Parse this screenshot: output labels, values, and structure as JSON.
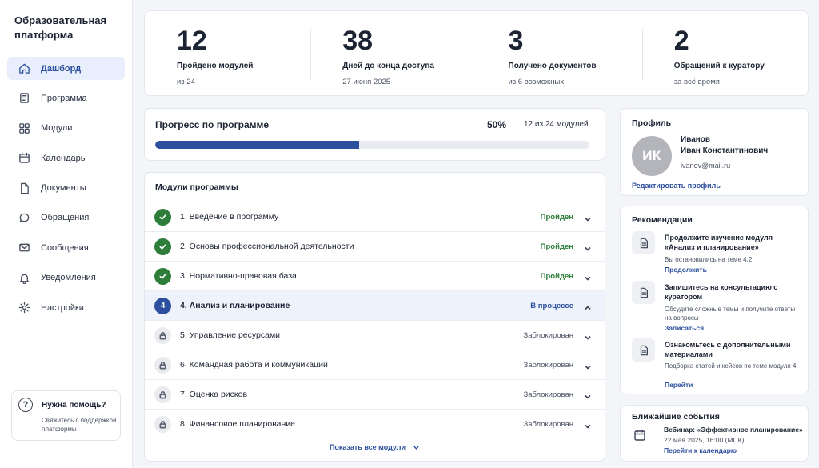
{
  "brand": {
    "line1": "Образовательная",
    "line2": "платформа"
  },
  "nav": [
    {
      "label": "Дашборд",
      "icon": "home-icon",
      "active": true
    },
    {
      "label": "Программа",
      "icon": "book-icon"
    },
    {
      "label": "Модули",
      "icon": "grid-icon"
    },
    {
      "label": "Календарь",
      "icon": "calendar-icon"
    },
    {
      "label": "Документы",
      "icon": "document-icon"
    },
    {
      "label": "Обращения",
      "icon": "chat-icon"
    },
    {
      "label": "Сообщения",
      "icon": "mail-icon"
    },
    {
      "label": "Уведомления",
      "icon": "bell-icon"
    },
    {
      "label": "Настройки",
      "icon": "gear-icon"
    }
  ],
  "help": {
    "icon": "?",
    "title": "Нужна помощь?",
    "subtitle": "Свяжитесь с поддержкой платформы"
  },
  "stats": [
    {
      "value": "12",
      "label": "Пройдено модулей",
      "sub": "из 24"
    },
    {
      "value": "38",
      "label": "Дней до конца доступа",
      "sub": "27 июня 2025"
    },
    {
      "value": "3",
      "label": "Получено документов",
      "sub": "из 6 возможных"
    },
    {
      "value": "2",
      "label": "Обращений к куратору",
      "sub": "за всё время"
    }
  ],
  "progress": {
    "title": "Прогресс по программе",
    "percent_label": "50%",
    "count_label": "12 из 24 модулей",
    "fraction": 0.47
  },
  "modules": {
    "title": "Модули программы",
    "items": [
      {
        "name": "1.  Введение в программу",
        "status": "Пройден",
        "state": "done"
      },
      {
        "name": "2.  Основы профессиональной деятельности",
        "status": "Пройден",
        "state": "done"
      },
      {
        "name": "3.  Нормативно-правовая база",
        "status": "Пройден",
        "state": "done"
      },
      {
        "name": "4.  Анализ и планирование",
        "status": "В процессе",
        "state": "current",
        "badge": "4"
      },
      {
        "name": "5.  Управление ресурсами",
        "status": "Заблокирован",
        "state": "locked"
      },
      {
        "name": "6.  Командная работа и коммуникации",
        "status": "Заблокирован",
        "state": "locked"
      },
      {
        "name": "7.  Оценка рисков",
        "status": "Заблокирован",
        "state": "locked"
      },
      {
        "name": "8.  Финансовое планирование",
        "status": "Заблокирован",
        "state": "locked"
      }
    ],
    "show_all": "Показать все модули"
  },
  "profile": {
    "title": "Профиль",
    "initials": "ИК",
    "surname": "Иванов",
    "given": "Иван Константинович",
    "email": "ivanov@mail.ru",
    "edit_link": "Редактировать профиль"
  },
  "recommendations": {
    "title": "Рекомендации",
    "items": [
      {
        "title": "Продолжите изучение модуля «Анализ и планирование»",
        "subtitle": "Вы остановились на теме 4.2",
        "link": "Продолжить"
      },
      {
        "title": "Запишитесь на консультацию с куратором",
        "subtitle": "Обсудите сложные темы и получите ответы на вопросы",
        "link": "Записаться"
      },
      {
        "title": "Ознакомьтесь с дополнительными материалами",
        "subtitle": "Подборка статей и кейсов по теме модуля 4",
        "link": "Перейти"
      }
    ]
  },
  "events": {
    "title": "Ближайшие события",
    "event_title": "Вебинар: «Эффективное планирование»",
    "event_date": "22 мая 2025, 16:00 (МСК)",
    "link": "Перейти к календарю"
  },
  "colors": {
    "accent": "#2c4f9e",
    "success": "#2e7d3a",
    "active_nav_bg": "#e8eefb",
    "background": "#f3f5f9"
  }
}
